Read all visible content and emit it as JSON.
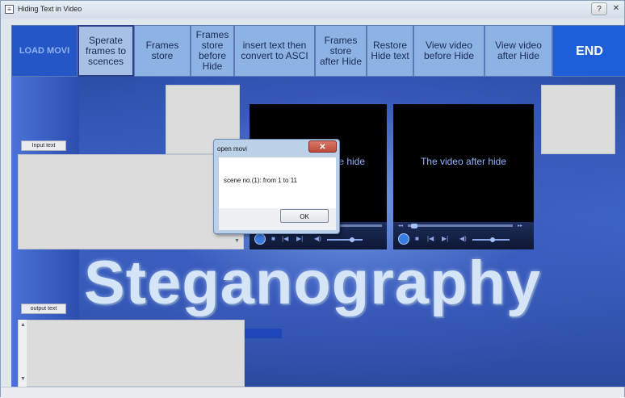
{
  "window": {
    "title": "Hiding Text in Video",
    "help_label": "?",
    "close_label": "✕"
  },
  "toolbar": {
    "buttons": [
      {
        "label": "LOAD MOVI"
      },
      {
        "label": "Sperate\nframes to\nscences"
      },
      {
        "label": "Frames\nstore"
      },
      {
        "label": "Frames\nstore\nbefore\nHide"
      },
      {
        "label": "insert text then\nconvert to ASCI"
      },
      {
        "label": "Frames\nstore\nafter Hide"
      },
      {
        "label": "Restore\nHide text"
      },
      {
        "label": "View video\nbefore Hide"
      },
      {
        "label": "View video\nafter Hide"
      },
      {
        "label": "END"
      }
    ]
  },
  "panels": {
    "input_label": "Input text",
    "output_label": "output text",
    "banner": "Steganography"
  },
  "players": {
    "before": {
      "title": "The video before hide"
    },
    "after": {
      "title": "The video after hide"
    }
  },
  "dialog": {
    "title": "open movi",
    "close_label": "✕",
    "message": "scene no.(1): from  1   to   11",
    "ok_label": "OK"
  },
  "icons": {
    "prev": "|◀",
    "next": "▶|",
    "stop": "■",
    "volume": "◀)",
    "up": "▲",
    "down": "▼",
    "rewind": "◂◂",
    "forward": "▸▸"
  }
}
